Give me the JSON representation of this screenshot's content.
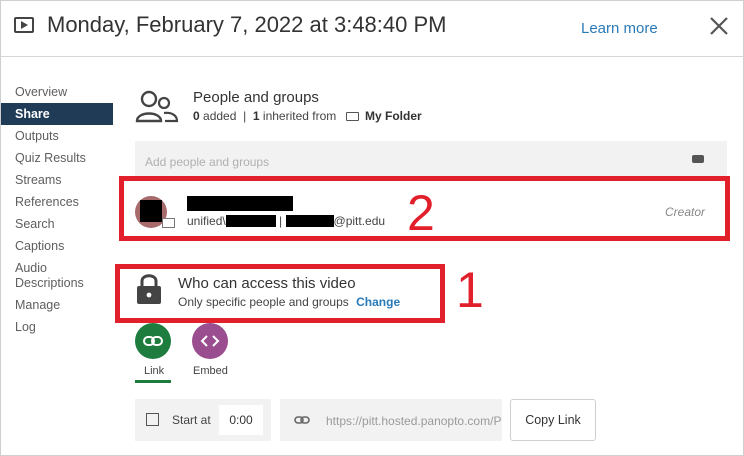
{
  "header": {
    "title": "Monday, February 7, 2022 at 3:48:40 PM",
    "learn_more": "Learn more",
    "icons": {
      "video": "video-icon",
      "close": "close-icon"
    }
  },
  "sidebar": {
    "items": [
      {
        "label": "Overview",
        "active": false
      },
      {
        "label": "Share",
        "active": true
      },
      {
        "label": "Outputs",
        "active": false
      },
      {
        "label": "Quiz Results",
        "active": false
      },
      {
        "label": "Streams",
        "active": false
      },
      {
        "label": "References",
        "active": false
      },
      {
        "label": "Search",
        "active": false
      },
      {
        "label": "Captions",
        "active": false
      },
      {
        "label": "Audio Descriptions",
        "active": false
      },
      {
        "label": "Manage",
        "active": false
      },
      {
        "label": "Log",
        "active": false
      }
    ]
  },
  "people": {
    "title": "People and groups",
    "added_count": "0",
    "added_label": "added",
    "inherited_count": "1",
    "inherited_label": "inherited from",
    "folder": "My Folder",
    "add_placeholder": "Add people and groups"
  },
  "user": {
    "email_prefix": "unified\\",
    "email_sep": "|",
    "email_suffix": "@pitt.edu",
    "role": "Creator"
  },
  "access": {
    "title": "Who can access this video",
    "description": "Only specific people and groups",
    "change": "Change"
  },
  "annotations": {
    "box1_number": "1",
    "box2_number": "2",
    "color": "#e2202c"
  },
  "tabs": [
    {
      "label": "Link",
      "active": true,
      "color": "#1e7c3e",
      "icon": "link-icon"
    },
    {
      "label": "Embed",
      "active": false,
      "color": "#9a4e8f",
      "icon": "code-icon"
    }
  ],
  "share_link": {
    "start_at_label": "Start at",
    "start_time": "0:00",
    "url": "https://pitt.hosted.panopto.com/Panopto/Pages/Viewer.aspx",
    "copy_label": "Copy Link"
  }
}
